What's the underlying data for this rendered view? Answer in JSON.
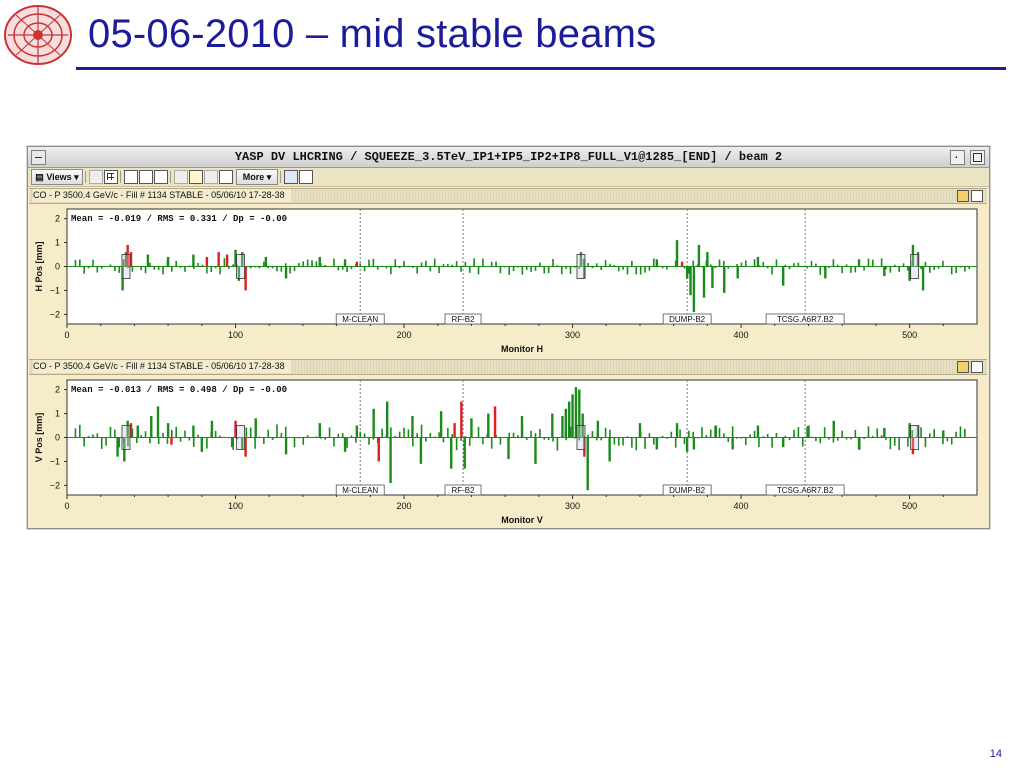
{
  "slide": {
    "title": "05-06-2010 – mid stable beams",
    "page_number": "14",
    "accent_color": "#1c1c9a"
  },
  "window": {
    "title": "YASP DV LHCRING / SQUEEZE_3.5TeV_IP1+IP5_IP2+IP8_FULL_V1@1285_[END] / beam 2",
    "toolbar": {
      "views_label": "Views",
      "more_label": "More"
    }
  },
  "panels": [
    {
      "header": "CO - P 3500.4 GeV/c - Fill # 1134 STABLE - 05/06/10 17-28-38",
      "stats": "Mean =  -0.019 / RMS =   0.331 / Dp =  -0.00"
    },
    {
      "header": "CO - P 3500.4 GeV/c - Fill # 1134 STABLE - 05/06/10 17-28-38",
      "stats": "Mean =  -0.013 / RMS =   0.498 / Dp =  -0.00"
    }
  ],
  "chart_data": [
    {
      "type": "bar",
      "xlabel": "Monitor H",
      "ylabel": "H Pos [mm]",
      "xlim": [
        0,
        540
      ],
      "ylim": [
        -2.4,
        2.4
      ],
      "xticks": [
        0,
        100,
        200,
        300,
        400,
        500
      ],
      "yticks": [
        2,
        1,
        0,
        -1,
        -2
      ],
      "colors": {
        "normal": "#1a8a1a",
        "flagged": "#e02020"
      },
      "markers": [
        {
          "label": "M-CLEAN",
          "x": 174
        },
        {
          "label": "RF-B2",
          "x": 235
        },
        {
          "label": "DUMP-B2",
          "x": 368
        },
        {
          "label": "TCSG.A6R7.B2",
          "x": 438
        }
      ],
      "boxes": [
        35,
        103,
        305,
        503
      ],
      "series": [
        {
          "x": 33,
          "value": -1.0
        },
        {
          "x": 35,
          "value": 0.6
        },
        {
          "x": 36,
          "value": 0.9,
          "flag": true
        },
        {
          "x": 38,
          "value": 0.6,
          "flag": true
        },
        {
          "x": 48,
          "value": 0.5
        },
        {
          "x": 60,
          "value": 0.4
        },
        {
          "x": 75,
          "value": 0.5
        },
        {
          "x": 83,
          "value": 0.4,
          "flag": true
        },
        {
          "x": 90,
          "value": 0.6,
          "flag": true
        },
        {
          "x": 95,
          "value": 0.5,
          "flag": true
        },
        {
          "x": 100,
          "value": 0.7
        },
        {
          "x": 102,
          "value": -0.6
        },
        {
          "x": 104,
          "value": 0.6
        },
        {
          "x": 106,
          "value": -1.0,
          "flag": true
        },
        {
          "x": 118,
          "value": 0.4
        },
        {
          "x": 130,
          "value": -0.5
        },
        {
          "x": 150,
          "value": 0.4
        },
        {
          "x": 165,
          "value": 0.3
        },
        {
          "x": 172,
          "value": 0.2,
          "flag": true
        },
        {
          "x": 305,
          "value": 0.6
        },
        {
          "x": 307,
          "value": -0.5
        },
        {
          "x": 350,
          "value": 0.3
        },
        {
          "x": 362,
          "value": 1.1
        },
        {
          "x": 365,
          "value": 0.2,
          "flag": true
        },
        {
          "x": 368,
          "value": -0.5
        },
        {
          "x": 370,
          "value": -1.2
        },
        {
          "x": 372,
          "value": -1.9
        },
        {
          "x": 375,
          "value": 0.9
        },
        {
          "x": 378,
          "value": -1.3
        },
        {
          "x": 380,
          "value": 0.6
        },
        {
          "x": 383,
          "value": -0.9
        },
        {
          "x": 390,
          "value": -1.1
        },
        {
          "x": 398,
          "value": -0.5
        },
        {
          "x": 410,
          "value": 0.4
        },
        {
          "x": 425,
          "value": -0.8
        },
        {
          "x": 450,
          "value": -0.5
        },
        {
          "x": 470,
          "value": 0.3
        },
        {
          "x": 485,
          "value": -0.4
        },
        {
          "x": 500,
          "value": -0.6
        },
        {
          "x": 502,
          "value": 0.9
        },
        {
          "x": 505,
          "value": 0.6
        },
        {
          "x": 508,
          "value": -1.0
        }
      ]
    },
    {
      "type": "bar",
      "xlabel": "Monitor V",
      "ylabel": "V Pos [mm]",
      "xlim": [
        0,
        540
      ],
      "ylim": [
        -2.4,
        2.4
      ],
      "xticks": [
        0,
        100,
        200,
        300,
        400,
        500
      ],
      "yticks": [
        2,
        1,
        0,
        -1,
        -2
      ],
      "colors": {
        "normal": "#1a8a1a",
        "flagged": "#e02020"
      },
      "markers": [
        {
          "label": "M-CLEAN",
          "x": 174
        },
        {
          "label": "RF-B2",
          "x": 235
        },
        {
          "label": "DUMP-B2",
          "x": 368
        },
        {
          "label": "TCSG.A6R7.B2",
          "x": 438
        }
      ],
      "boxes": [
        35,
        103,
        305,
        503
      ],
      "series": [
        {
          "x": 30,
          "value": -0.8
        },
        {
          "x": 34,
          "value": -1.0
        },
        {
          "x": 36,
          "value": 0.7
        },
        {
          "x": 38,
          "value": 0.6,
          "flag": true
        },
        {
          "x": 42,
          "value": 0.5
        },
        {
          "x": 50,
          "value": 0.9
        },
        {
          "x": 54,
          "value": 1.3
        },
        {
          "x": 60,
          "value": 0.6
        },
        {
          "x": 62,
          "value": -0.3,
          "flag": true
        },
        {
          "x": 75,
          "value": 0.5
        },
        {
          "x": 80,
          "value": -0.6
        },
        {
          "x": 86,
          "value": 0.7
        },
        {
          "x": 98,
          "value": -0.4
        },
        {
          "x": 100,
          "value": 0.7,
          "flag": true
        },
        {
          "x": 104,
          "value": -0.5
        },
        {
          "x": 106,
          "value": -0.8,
          "flag": true
        },
        {
          "x": 112,
          "value": 0.8
        },
        {
          "x": 130,
          "value": -0.7
        },
        {
          "x": 150,
          "value": 0.6
        },
        {
          "x": 165,
          "value": -0.6
        },
        {
          "x": 172,
          "value": 0.5
        },
        {
          "x": 182,
          "value": 1.2
        },
        {
          "x": 185,
          "value": -1.0,
          "flag": true
        },
        {
          "x": 190,
          "value": 1.5
        },
        {
          "x": 192,
          "value": -1.9
        },
        {
          "x": 205,
          "value": 0.9
        },
        {
          "x": 210,
          "value": -1.1
        },
        {
          "x": 222,
          "value": 1.1
        },
        {
          "x": 228,
          "value": -1.3
        },
        {
          "x": 230,
          "value": 0.6,
          "flag": true
        },
        {
          "x": 234,
          "value": 1.5,
          "flag": true
        },
        {
          "x": 236,
          "value": -1.3
        },
        {
          "x": 240,
          "value": 0.8
        },
        {
          "x": 250,
          "value": 1.0
        },
        {
          "x": 254,
          "value": 1.3,
          "flag": true
        },
        {
          "x": 262,
          "value": -0.9
        },
        {
          "x": 270,
          "value": 0.9
        },
        {
          "x": 278,
          "value": -1.1
        },
        {
          "x": 288,
          "value": 1.0
        },
        {
          "x": 294,
          "value": 0.9
        },
        {
          "x": 296,
          "value": 1.2
        },
        {
          "x": 298,
          "value": 1.5
        },
        {
          "x": 300,
          "value": 1.8
        },
        {
          "x": 302,
          "value": 2.1
        },
        {
          "x": 304,
          "value": 2.0
        },
        {
          "x": 306,
          "value": 1.0
        },
        {
          "x": 307,
          "value": -0.8,
          "flag": true
        },
        {
          "x": 309,
          "value": -2.2
        },
        {
          "x": 315,
          "value": 0.7
        },
        {
          "x": 322,
          "value": -1.0
        },
        {
          "x": 340,
          "value": 0.6
        },
        {
          "x": 350,
          "value": -0.5
        },
        {
          "x": 362,
          "value": 0.6
        },
        {
          "x": 368,
          "value": -0.6
        },
        {
          "x": 372,
          "value": -0.5
        },
        {
          "x": 385,
          "value": 0.5
        },
        {
          "x": 395,
          "value": -0.5
        },
        {
          "x": 410,
          "value": 0.5
        },
        {
          "x": 425,
          "value": -0.4
        },
        {
          "x": 440,
          "value": 0.5
        },
        {
          "x": 455,
          "value": 0.7
        },
        {
          "x": 470,
          "value": -0.5
        },
        {
          "x": 485,
          "value": 0.4
        },
        {
          "x": 500,
          "value": 0.6
        },
        {
          "x": 502,
          "value": -0.7,
          "flag": true
        },
        {
          "x": 505,
          "value": 0.5
        },
        {
          "x": 520,
          "value": 0.3
        }
      ]
    }
  ]
}
